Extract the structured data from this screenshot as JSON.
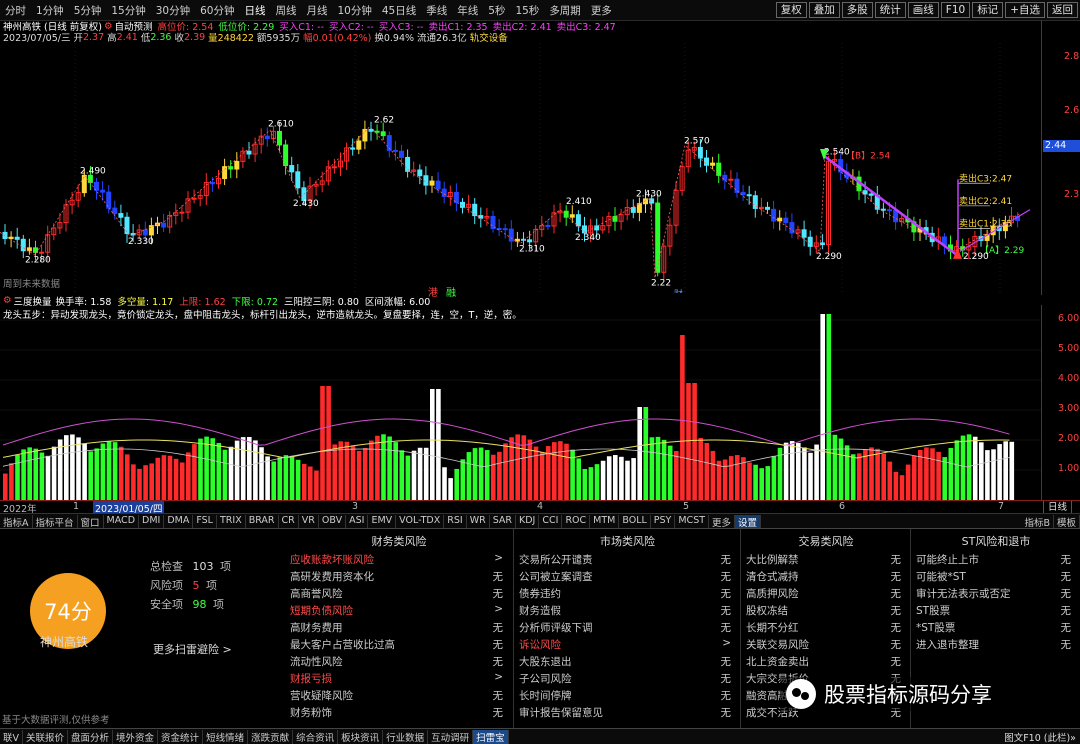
{
  "topbar": {
    "periods": [
      "分时",
      "1分钟",
      "5分钟",
      "15分钟",
      "30分钟",
      "60分钟",
      "日线",
      "周线",
      "月线",
      "10分钟",
      "45日线",
      "季线",
      "年线",
      "5秒",
      "15秒",
      "多周期",
      "更多"
    ],
    "active_period": "日线",
    "right_buttons": [
      "复权",
      "叠加",
      "多股",
      "统计",
      "画线",
      "F10",
      "标记",
      "+自选",
      "返回"
    ]
  },
  "stock": {
    "title": "神州高铁 (日线 前复权)",
    "indicator_name": "自动预测",
    "signals": [
      {
        "label": "高位价: 2.54",
        "color": "#ff4040"
      },
      {
        "label": "低位价: 2.29",
        "color": "#40ff40"
      },
      {
        "label": "买入C1: --",
        "color": "#ff3fff"
      },
      {
        "label": "买入C2: --",
        "color": "#ff3fff"
      },
      {
        "label": "买入C3: --",
        "color": "#ff3fff"
      },
      {
        "label": "卖出C1: 2.35",
        "color": "#ff3fff"
      },
      {
        "label": "卖出C2: 2.41",
        "color": "#ff3fff"
      },
      {
        "label": "卖出C3: 2.47",
        "color": "#ff3fff"
      }
    ],
    "ohlc_line": {
      "date": "2023/07/05/三",
      "open_label": "开",
      "open": "2.37",
      "high_label": "高",
      "high": "2.41",
      "low_label": "低",
      "low": "2.36",
      "close_label": "收",
      "close": "2.39",
      "volume": "量248422",
      "amount": "额5935万",
      "change": "幅0.01(0.42%)",
      "turnover": "换0.94%",
      "circulation": "流通26.3亿",
      "sector": "轨交设备"
    },
    "future_note": "周到未来数据",
    "markers": [
      "港",
      "融"
    ]
  },
  "kline_labels": {
    "highs": [
      "2.490",
      "2.610",
      "2.62",
      "2.410",
      "2.430",
      "2.570",
      "2.540"
    ],
    "lows": [
      "2.280",
      "2.330",
      "2.430",
      "2.310",
      "2.340",
      "2.22",
      "2.290"
    ],
    "signal_tags": [
      "卖出C3:2.47",
      "卖出C2:2.41",
      "卖出C1:2.35",
      "【A】2.29",
      "【B】2.54"
    ],
    "low_tag": "2.290",
    "marker_cai": "财"
  },
  "price_axis": {
    "ticks": [
      "2.81",
      "2.61",
      "2.44",
      "2.37"
    ],
    "highlight": "2.44"
  },
  "vol_indicator": {
    "name": "三度换量",
    "items": [
      {
        "label": "换手率: 1.58",
        "color": "#ffffff"
      },
      {
        "label": "多空量: 1.17",
        "color": "#ffff40"
      },
      {
        "label": "上限: 1.62",
        "color": "#ff4040"
      },
      {
        "label": "下限: 0.72",
        "color": "#40ff40"
      },
      {
        "label": "三阳控三阴: 0.80",
        "color": "#ffffff"
      },
      {
        "label": "区间涨幅: 6.00",
        "color": "#ffffff"
      }
    ],
    "desc": "龙头五步：异动发现龙头，竟价锁定龙头，盘中阻击龙头，标杆引出龙头，逆市造就龙头。复盘要择，连，空，T，逆，密。"
  },
  "vol_axis": {
    "ticks": [
      "6.00",
      "5.00",
      "4.00",
      "3.00",
      "2.00",
      "1.00"
    ]
  },
  "date_axis": {
    "labels": [
      "2022年",
      "1",
      "2023/01/05/四",
      "3",
      "4",
      "5",
      "6",
      "7"
    ],
    "right_btn": "日线"
  },
  "tabbar": {
    "tabs": [
      "指标A",
      "指标平台",
      "窗口",
      "MACD",
      "DMI",
      "DMA",
      "FSL",
      "TRIX",
      "BRAR",
      "CR",
      "VR",
      "OBV",
      "ASI",
      "EMV",
      "VOL-TDX",
      "RSI",
      "WR",
      "SAR",
      "KDJ",
      "CCI",
      "ROC",
      "MTM",
      "BOLL",
      "PSY",
      "MCST",
      "更多",
      "设置"
    ],
    "active": "设置",
    "right_tabs": [
      "指标B",
      "模板"
    ]
  },
  "risk": {
    "score": "74分",
    "stock_name": "神州高铁",
    "total_label": "总检查",
    "total": "103",
    "unit": "项",
    "risk_label": "风险项",
    "risk_count": "5",
    "safe_label": "安全项",
    "safe_count": "98",
    "more": "更多扫雷避险 >",
    "disclaimer": "基于大数据评测,仅供参考",
    "columns": [
      {
        "title": "财务类风险",
        "items": [
          {
            "label": "应收账款坏账风险",
            "value": ">",
            "risk": true
          },
          {
            "label": "高研发费用资本化",
            "value": "无"
          },
          {
            "label": "高商誉风险",
            "value": "无"
          },
          {
            "label": "短期负债风险",
            "value": ">",
            "risk": true
          },
          {
            "label": "高财务费用",
            "value": "无"
          },
          {
            "label": "最大客户占营收比过高",
            "value": "无"
          },
          {
            "label": "流动性风险",
            "value": "无"
          },
          {
            "label": "财报亏损",
            "value": ">",
            "risk": true
          },
          {
            "label": "营收疑降风险",
            "value": "无"
          },
          {
            "label": "财务粉饰",
            "value": "无"
          }
        ]
      },
      {
        "title": "市场类风险",
        "items": [
          {
            "label": "交易所公开谴责",
            "value": "无"
          },
          {
            "label": "公司被立案调查",
            "value": "无"
          },
          {
            "label": "债券违约",
            "value": "无"
          },
          {
            "label": "财务造假",
            "value": "无"
          },
          {
            "label": "分析师评级下调",
            "value": "无"
          },
          {
            "label": "诉讼风险",
            "value": ">",
            "risk": true
          },
          {
            "label": "大股东退出",
            "value": "无"
          },
          {
            "label": "子公司风险",
            "value": "无"
          },
          {
            "label": "长时间停牌",
            "value": "无"
          },
          {
            "label": "审计报告保留意见",
            "value": "无"
          }
        ]
      },
      {
        "title": "交易类风险",
        "items": [
          {
            "label": "大比例解禁",
            "value": "无"
          },
          {
            "label": "清仓式减持",
            "value": "无"
          },
          {
            "label": "高质押风险",
            "value": "无"
          },
          {
            "label": "股权冻结",
            "value": "无"
          },
          {
            "label": "长期不分红",
            "value": "无"
          },
          {
            "label": "关联交易风险",
            "value": "无"
          },
          {
            "label": "北上资金卖出",
            "value": "无"
          },
          {
            "label": "大宗交易折价",
            "value": "无"
          },
          {
            "label": "融资高融",
            "value": "无"
          },
          {
            "label": "成交不活跃",
            "value": "无"
          }
        ]
      },
      {
        "title": "ST风险和退市",
        "items": [
          {
            "label": "可能终止上市",
            "value": "无"
          },
          {
            "label": "可能被*ST",
            "value": "无"
          },
          {
            "label": "审计无法表示或否定",
            "value": "无"
          },
          {
            "label": "ST股票",
            "value": "无"
          },
          {
            "label": "*ST股票",
            "value": "无"
          },
          {
            "label": "进入退市整理",
            "value": "无"
          }
        ]
      }
    ],
    "watermark": "股票指标源码分享"
  },
  "bottombar": {
    "tabs": [
      "联V",
      "关联报价",
      "盘面分析",
      "境外资金",
      "资金统计",
      "短线情绪",
      "涨跌贡献",
      "综合资讯",
      "板块资讯",
      "行业数据",
      "互动调研",
      "扫雷宝"
    ],
    "active": "扫雷宝",
    "right": "图文F10  (此栏)»"
  },
  "colors": {
    "up": "#ff2a2a",
    "down": "#2aff2a",
    "cyan": "#4fe8ff",
    "yellow": "#ffd83a",
    "magenta": "#c040ff",
    "blue": "#2244ff",
    "score": "#f5a020"
  }
}
